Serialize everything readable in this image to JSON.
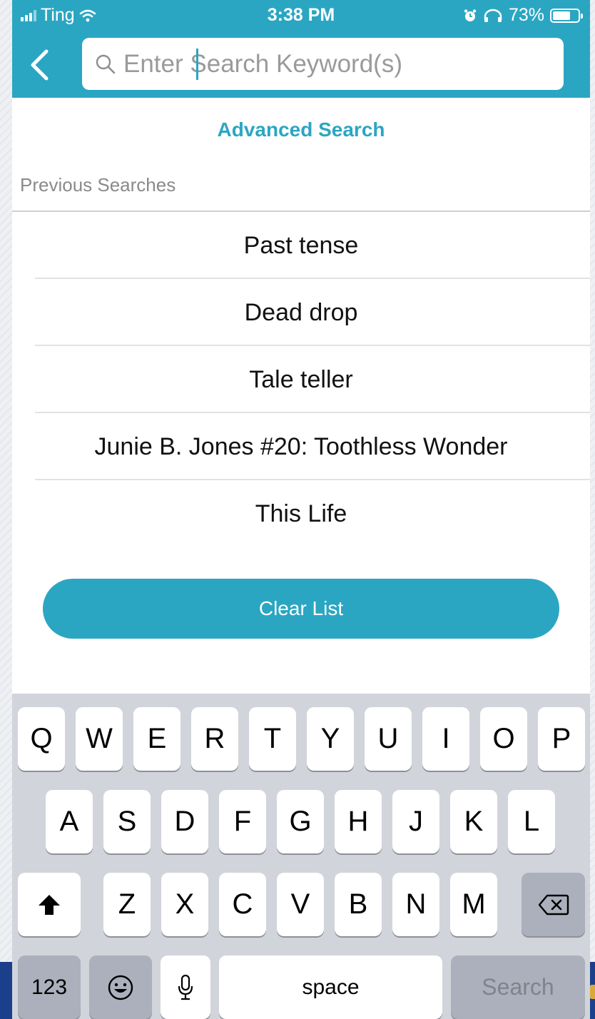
{
  "status_bar": {
    "carrier": "Ting",
    "time": "3:38 PM",
    "battery": "73%",
    "battery_level": 0.73
  },
  "header": {
    "search_placeholder": "Enter Search Keyword(s)"
  },
  "advanced_search_label": "Advanced Search",
  "previous_searches_label": "Previous Searches",
  "previous_searches": [
    "Past tense",
    "Dead drop",
    "Tale teller",
    "Junie B. Jones #20: Toothless Wonder",
    "This Life"
  ],
  "clear_list_label": "Clear List",
  "keyboard": {
    "row1": [
      "Q",
      "W",
      "E",
      "R",
      "T",
      "Y",
      "U",
      "I",
      "O",
      "P"
    ],
    "row2": [
      "A",
      "S",
      "D",
      "F",
      "G",
      "H",
      "J",
      "K",
      "L"
    ],
    "row3": [
      "Z",
      "X",
      "C",
      "V",
      "B",
      "N",
      "M"
    ],
    "numbers_label": "123",
    "space_label": "space",
    "search_label": "Search"
  },
  "colors": {
    "accent": "#2ba6c2",
    "keyboard_bg": "#d1d4da"
  },
  "icons": [
    "signal-icon",
    "wifi-icon",
    "alarm-icon",
    "headphones-icon",
    "battery-icon",
    "back-chevron-icon",
    "search-icon",
    "shift-icon",
    "delete-icon",
    "emoji-icon",
    "microphone-icon"
  ]
}
